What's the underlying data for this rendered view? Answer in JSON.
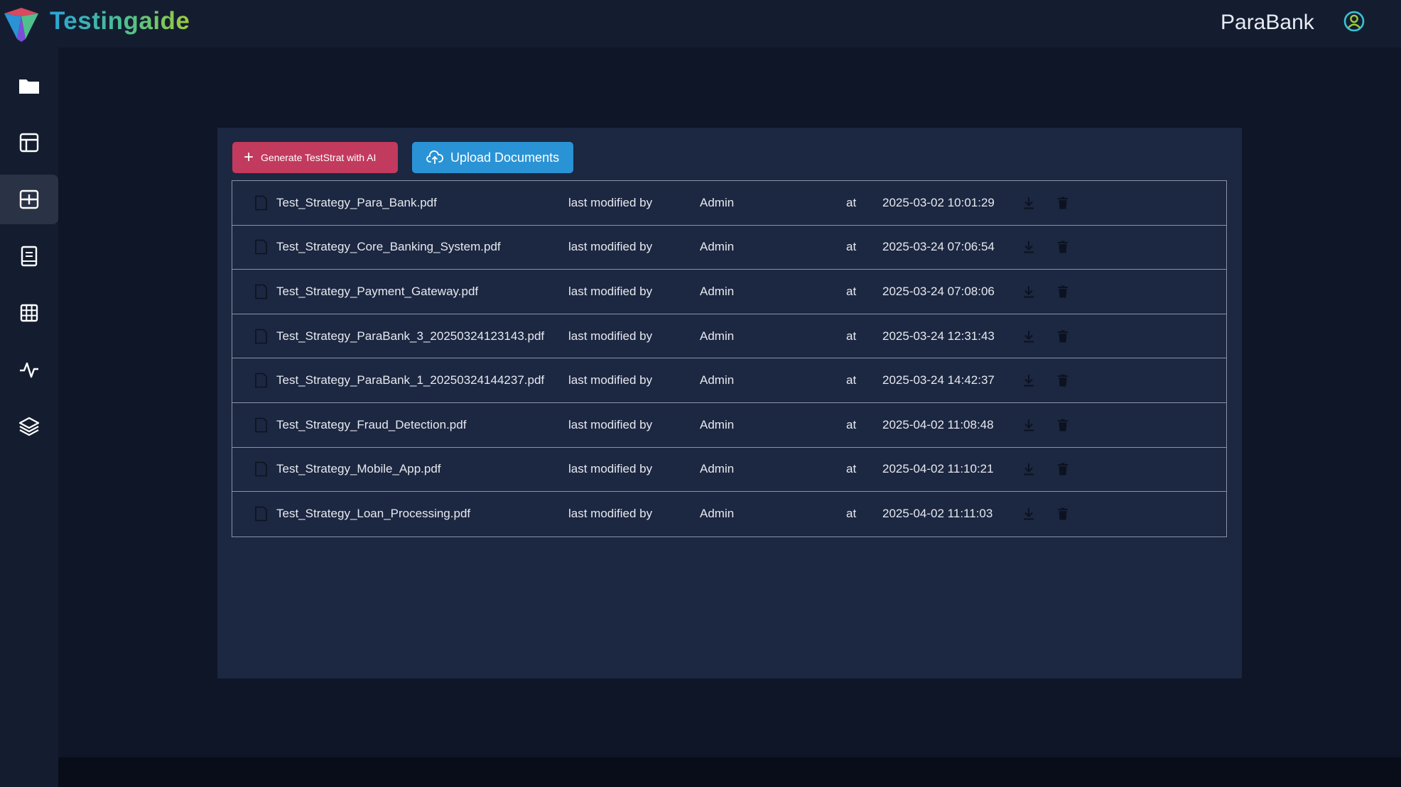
{
  "header": {
    "brand": "Testingaide",
    "project_name": "ParaBank",
    "user_icon": "user-circle-icon"
  },
  "sidebar": {
    "items": [
      {
        "icon": "folder-icon",
        "active": false
      },
      {
        "icon": "layout-icon",
        "active": false
      },
      {
        "icon": "add-box-icon",
        "active": true
      },
      {
        "icon": "book-icon",
        "active": false
      },
      {
        "icon": "grid-table-icon",
        "active": false
      },
      {
        "icon": "activity-icon",
        "active": false
      },
      {
        "icon": "layers-icon",
        "active": false
      }
    ]
  },
  "toolbar": {
    "generate_label": "Generate TestStrat with AI",
    "upload_label": "Upload Documents",
    "generate_color": "#c23a5e",
    "upload_color": "#2a93d5"
  },
  "documents": [
    {
      "name": "Test_Strategy_Para_Bank.pdf",
      "modified_label": "last modified by",
      "user": "Admin",
      "at_label": "at",
      "timestamp": "2025-03-02 10:01:29"
    },
    {
      "name": "Test_Strategy_Core_Banking_System.pdf",
      "modified_label": "last modified by",
      "user": "Admin",
      "at_label": "at",
      "timestamp": "2025-03-24 07:06:54"
    },
    {
      "name": "Test_Strategy_Payment_Gateway.pdf",
      "modified_label": "last modified by",
      "user": "Admin",
      "at_label": "at",
      "timestamp": "2025-03-24 07:08:06"
    },
    {
      "name": "Test_Strategy_ParaBank_3_20250324123143.pdf",
      "modified_label": "last modified by",
      "user": "Admin",
      "at_label": "at",
      "timestamp": "2025-03-24 12:31:43"
    },
    {
      "name": "Test_Strategy_ParaBank_1_20250324144237.pdf",
      "modified_label": "last modified by",
      "user": "Admin",
      "at_label": "at",
      "timestamp": "2025-03-24 14:42:37"
    },
    {
      "name": "Test_Strategy_Fraud_Detection.pdf",
      "modified_label": "last modified by",
      "user": "Admin",
      "at_label": "at",
      "timestamp": "2025-04-02 11:08:48"
    },
    {
      "name": "Test_Strategy_Mobile_App.pdf",
      "modified_label": "last modified by",
      "user": "Admin",
      "at_label": "at",
      "timestamp": "2025-04-02 11:10:21"
    },
    {
      "name": "Test_Strategy_Loan_Processing.pdf",
      "modified_label": "last modified by",
      "user": "Admin",
      "at_label": "at",
      "timestamp": "2025-04-02 11:11:03"
    }
  ]
}
